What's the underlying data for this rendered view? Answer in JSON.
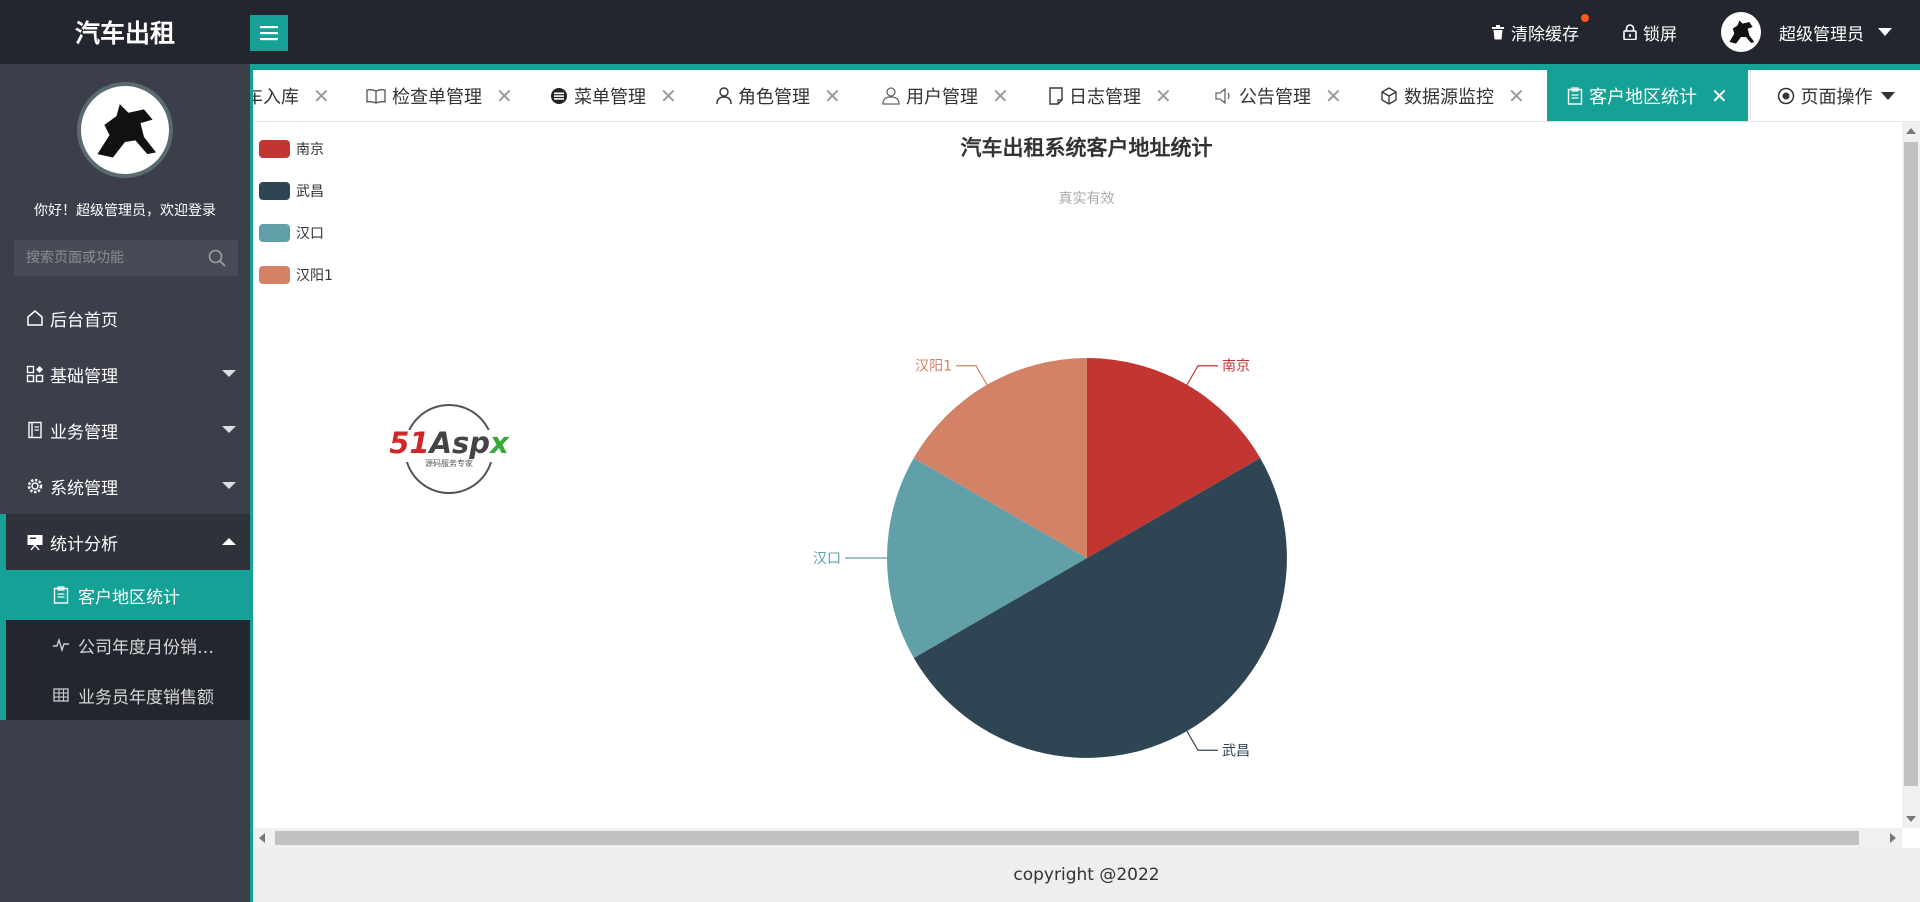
{
  "app": {
    "title": "汽车出租",
    "clear_cache": "清除缓存",
    "lock_screen": "锁屏",
    "user_name": "超级管理员"
  },
  "sidebar": {
    "welcome": "你好！超级管理员，欢迎登录",
    "search_placeholder": "搜索页面或功能",
    "items": [
      {
        "label": "后台首页",
        "icon": "home-icon"
      },
      {
        "label": "基础管理",
        "icon": "grid-icon"
      },
      {
        "label": "业务管理",
        "icon": "book-icon"
      },
      {
        "label": "系统管理",
        "icon": "gear-icon"
      },
      {
        "label": "统计分析",
        "icon": "presentation-icon"
      }
    ],
    "sub_items": [
      {
        "label": "客户地区统计",
        "icon": "clipboard-icon"
      },
      {
        "label": "公司年度月份销…",
        "icon": "pulse-icon"
      },
      {
        "label": "业务员年度销售额",
        "icon": "table-icon"
      }
    ]
  },
  "tabs": [
    {
      "label": "车入库",
      "icon": ""
    },
    {
      "label": "检查单管理",
      "icon": "book-open-icon"
    },
    {
      "label": "菜单管理",
      "icon": "menu-circle-icon"
    },
    {
      "label": "角色管理",
      "icon": "person-icon"
    },
    {
      "label": "用户管理",
      "icon": "user-icon"
    },
    {
      "label": "日志管理",
      "icon": "note-icon"
    },
    {
      "label": "公告管理",
      "icon": "speaker-icon"
    },
    {
      "label": "数据源监控",
      "icon": "cube-icon"
    },
    {
      "label": "客户地区统计",
      "icon": "clipboard-icon"
    }
  ],
  "page_ops": "页面操作",
  "footer": "copyright @2022",
  "watermark": {
    "brand": "51Aspx",
    "tagline": "源码服务专家"
  },
  "colors": {
    "accent": "#16a196",
    "header": "#23262e",
    "sidebar": "#3c3f4a"
  },
  "chart_data": {
    "type": "pie",
    "title": "汽车出租系统客户地址统计",
    "subtitle": "真实有效",
    "legend_position": "top-left",
    "series": [
      {
        "name": "南京",
        "value": 1,
        "color": "#c23531"
      },
      {
        "name": "武昌",
        "value": 3,
        "color": "#2f4554"
      },
      {
        "name": "汉口",
        "value": 1,
        "color": "#61a0a8"
      },
      {
        "name": "汉阳1",
        "value": 1,
        "color": "#d48265"
      }
    ]
  }
}
